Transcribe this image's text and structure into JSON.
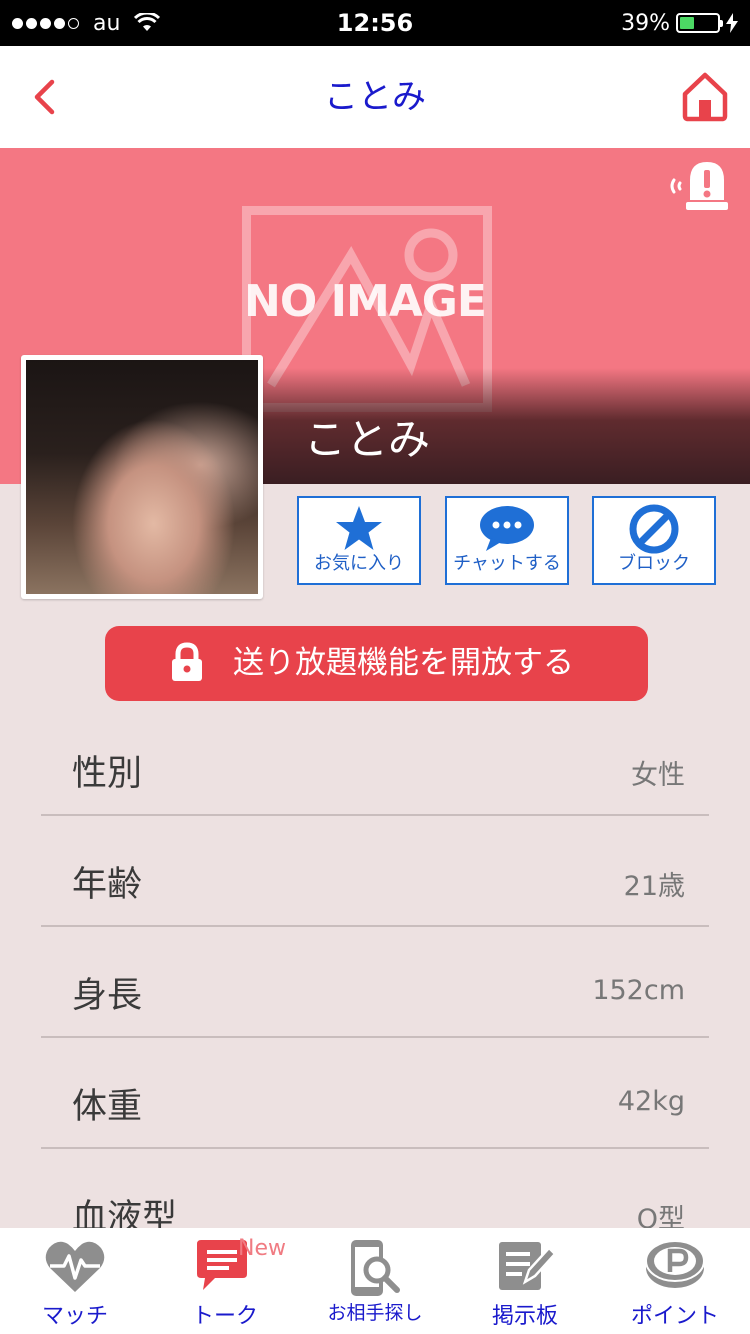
{
  "status_bar": {
    "carrier": "au",
    "time": "12:56",
    "battery_percent_text": "39%",
    "battery_level": 0.39,
    "signal_bars_filled": 4,
    "signal_bars_total": 5
  },
  "nav": {
    "title": "ことみ",
    "accent_color": "#e8434b"
  },
  "cover": {
    "placeholder_text": "NO IMAGE",
    "name": "ことみ",
    "background_color": "#f47783"
  },
  "actions": [
    {
      "label": "お気に入り",
      "icon": "star-icon"
    },
    {
      "label": "チャットする",
      "icon": "chat-bubble-icon"
    },
    {
      "label": "ブロック",
      "icon": "block-icon"
    }
  ],
  "unlock": {
    "label": "送り放題機能を開放する",
    "icon": "lock-icon"
  },
  "profile": [
    {
      "label": "性別",
      "value": "女性"
    },
    {
      "label": "年齢",
      "value": "21歳"
    },
    {
      "label": "身長",
      "value": "152cm"
    },
    {
      "label": "体重",
      "value": "42kg"
    },
    {
      "label": "血液型",
      "value": "O型"
    }
  ],
  "tabs": [
    {
      "label": "マッチ",
      "icon": "heartbeat-icon"
    },
    {
      "label": "トーク",
      "icon": "talk-icon",
      "badge": "New"
    },
    {
      "label": "お相手探し",
      "icon": "search-phone-icon"
    },
    {
      "label": "掲示板",
      "icon": "board-icon"
    },
    {
      "label": "ポイント",
      "icon": "point-coin-icon"
    }
  ]
}
